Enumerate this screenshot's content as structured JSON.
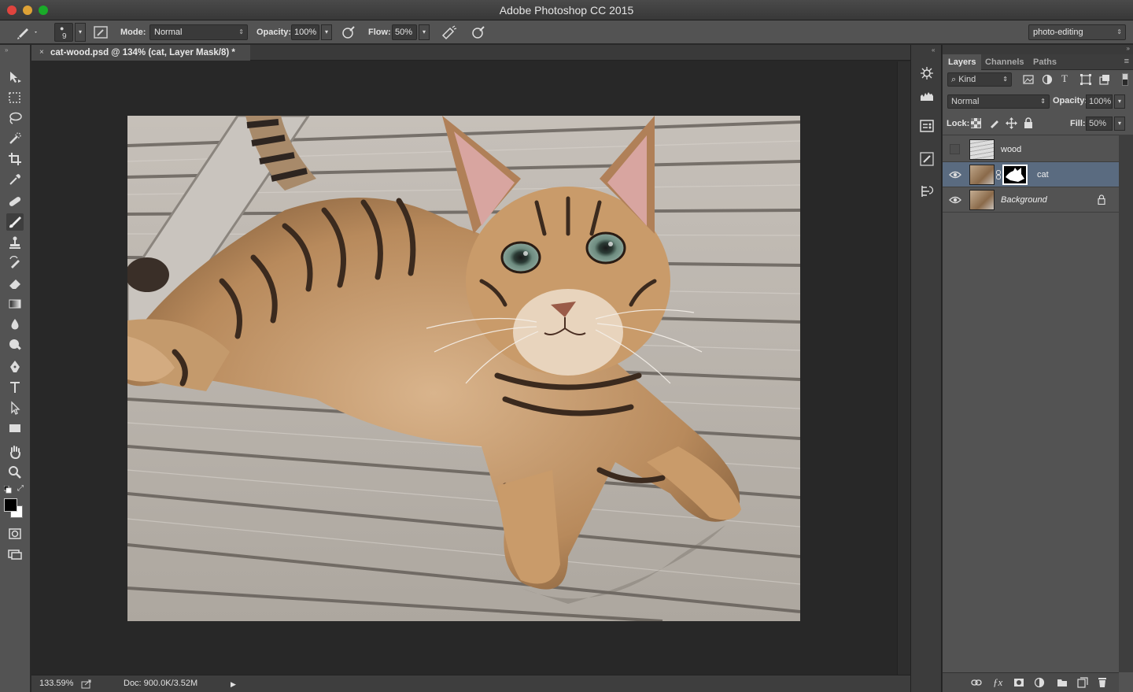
{
  "window": {
    "title": "Adobe Photoshop CC 2015",
    "workspace": "photo-editing"
  },
  "options": {
    "brush_size": "9",
    "mode_label": "Mode:",
    "mode_value": "Normal",
    "opacity_label": "Opacity:",
    "opacity_value": "100%",
    "flow_label": "Flow:",
    "flow_value": "50%"
  },
  "document": {
    "tab_title": "cat-wood.psd @ 134% (cat, Layer Mask/8) *",
    "close": "×"
  },
  "status": {
    "zoom": "133.59%",
    "doc_info": "Doc: 900.0K/3.52M"
  },
  "panels": {
    "tabs": [
      "Layers",
      "Channels",
      "Paths"
    ],
    "filter_kind": "Kind",
    "blend_mode": "Normal",
    "opacity_label": "Opacity:",
    "opacity_value": "100%",
    "lock_label": "Lock:",
    "fill_label": "Fill:",
    "fill_value": "50%"
  },
  "layers": [
    {
      "name": "wood",
      "visible": false,
      "selected": false,
      "has_mask": false,
      "locked": false
    },
    {
      "name": "cat",
      "visible": true,
      "selected": true,
      "has_mask": true,
      "locked": false
    },
    {
      "name": "Background",
      "visible": true,
      "selected": false,
      "has_mask": false,
      "locked": true
    }
  ],
  "colors": {
    "selection": "#5a6b80",
    "panel": "#535353",
    "canvas_bg": "#282828"
  },
  "icons": {
    "tools": [
      "move-icon",
      "marquee-icon",
      "lasso-icon",
      "quick-select-icon",
      "crop-icon",
      "eyedropper-icon",
      "healing-icon",
      "brush-icon",
      "clone-stamp-icon",
      "history-brush-icon",
      "eraser-icon",
      "gradient-icon",
      "blur-icon",
      "dodge-icon",
      "pen-icon",
      "type-icon",
      "path-select-icon",
      "rectangle-icon",
      "hand-icon",
      "zoom-icon"
    ]
  }
}
